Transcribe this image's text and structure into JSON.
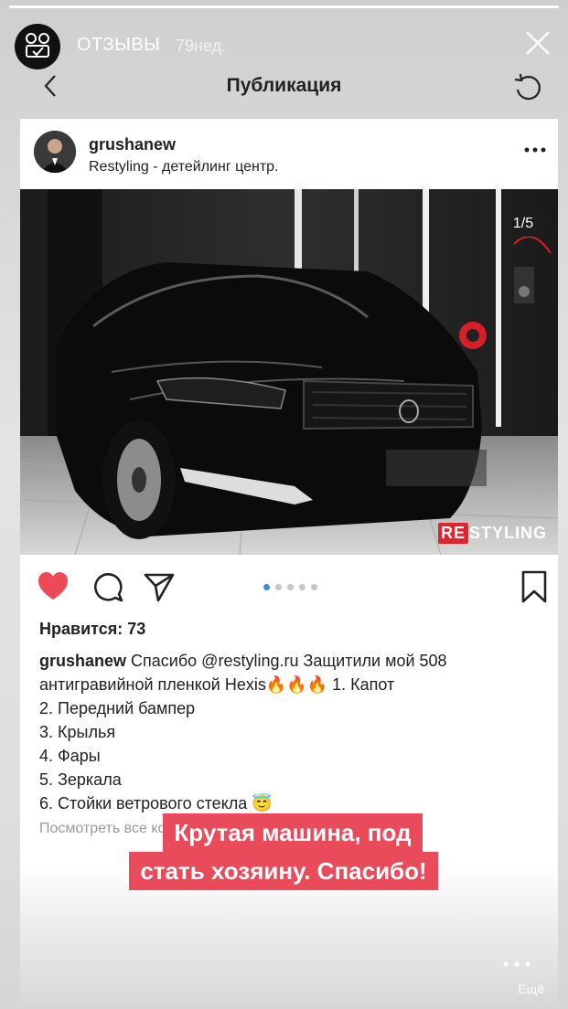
{
  "story": {
    "title": "ОТЗЫВЫ",
    "time": "79нед."
  },
  "nav": {
    "title": "Публикация"
  },
  "post": {
    "username": "grushanew",
    "location": "Restyling - детейлинг центр.",
    "counter": "1/5",
    "watermark_re": "RE",
    "watermark_rest": "STYLING",
    "likes": "Нравится: 73",
    "caption_user": "grushanew",
    "caption_lines": [
      "Спасибо @restyling.ru  Защитили мой 508",
      "антигравийной пленкой Hexis🔥🔥🔥 1. Капот",
      "2. Передний бампер",
      "3. Крылья",
      "4. Фары",
      "5. Зеркала",
      "6. Стойки ветрового стекла 😇"
    ],
    "more_comments": "Посмотреть все комментарии"
  },
  "sticker": {
    "line1": "Крутая машина, под",
    "line2": "стать хозяину. Спасибо!"
  },
  "footer": {
    "more_label": "Ещё"
  },
  "colors": {
    "like_red": "#ed4956",
    "sticker_red": "#ea4b5a",
    "dot_active": "#3b8fd6"
  }
}
